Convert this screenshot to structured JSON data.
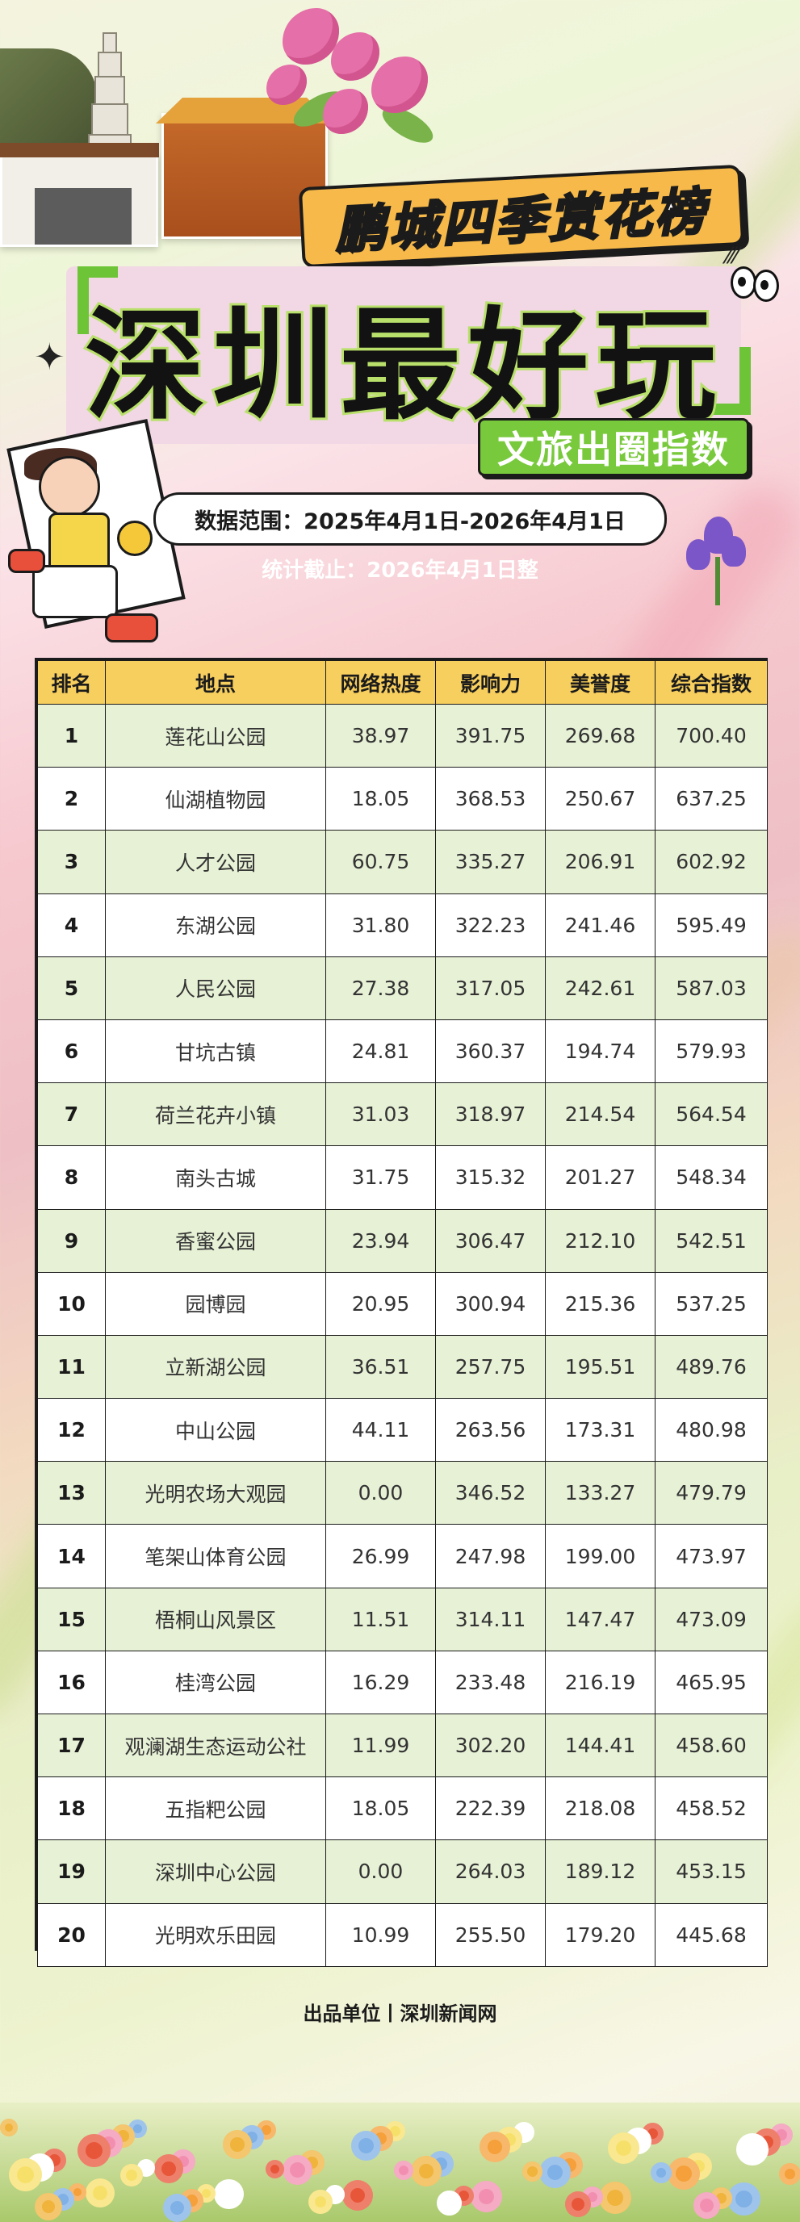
{
  "header": {
    "tag_title": "鹏城四季赏花榜",
    "main_title": "深圳最好玩",
    "sub_tag": "文旅出圈指数",
    "date_range": "数据范围：2025年4月1日-2026年4月1日",
    "cutoff": "统计截止：2026年4月1日整"
  },
  "table": {
    "headers": [
      "排名",
      "地点",
      "网络热度",
      "影响力",
      "美誉度",
      "综合指数"
    ],
    "rows": [
      [
        "1",
        "莲花山公园",
        "38.97",
        "391.75",
        "269.68",
        "700.40"
      ],
      [
        "2",
        "仙湖植物园",
        "18.05",
        "368.53",
        "250.67",
        "637.25"
      ],
      [
        "3",
        "人才公园",
        "60.75",
        "335.27",
        "206.91",
        "602.92"
      ],
      [
        "4",
        "东湖公园",
        "31.80",
        "322.23",
        "241.46",
        "595.49"
      ],
      [
        "5",
        "人民公园",
        "27.38",
        "317.05",
        "242.61",
        "587.03"
      ],
      [
        "6",
        "甘坑古镇",
        "24.81",
        "360.37",
        "194.74",
        "579.93"
      ],
      [
        "7",
        "荷兰花卉小镇",
        "31.03",
        "318.97",
        "214.54",
        "564.54"
      ],
      [
        "8",
        "南头古城",
        "31.75",
        "315.32",
        "201.27",
        "548.34"
      ],
      [
        "9",
        "香蜜公园",
        "23.94",
        "306.47",
        "212.10",
        "542.51"
      ],
      [
        "10",
        "园博园",
        "20.95",
        "300.94",
        "215.36",
        "537.25"
      ],
      [
        "11",
        "立新湖公园",
        "36.51",
        "257.75",
        "195.51",
        "489.76"
      ],
      [
        "12",
        "中山公园",
        "44.11",
        "263.56",
        "173.31",
        "480.98"
      ],
      [
        "13",
        "光明农场大观园",
        "0.00",
        "346.52",
        "133.27",
        "479.79"
      ],
      [
        "14",
        "笔架山体育公园",
        "26.99",
        "247.98",
        "199.00",
        "473.97"
      ],
      [
        "15",
        "梧桐山风景区",
        "11.51",
        "314.11",
        "147.47",
        "473.09"
      ],
      [
        "16",
        "桂湾公园",
        "16.29",
        "233.48",
        "216.19",
        "465.95"
      ],
      [
        "17",
        "观澜湖生态运动公社",
        "11.99",
        "302.20",
        "144.41",
        "458.60"
      ],
      [
        "18",
        "五指粑公园",
        "18.05",
        "222.39",
        "218.08",
        "458.52"
      ],
      [
        "19",
        "深圳中心公园",
        "0.00",
        "264.03",
        "189.12",
        "453.15"
      ],
      [
        "20",
        "光明欢乐田园",
        "10.99",
        "255.50",
        "179.20",
        "445.68"
      ]
    ]
  },
  "footer": {
    "credit": "出品单位丨深圳新闻网"
  },
  "colors": {
    "header_row": "#f7cf5e",
    "stripe_row": "#e7f1d6",
    "accent_green": "#79c93c",
    "accent_orange": "#f6b94a"
  },
  "decorations": [
    "pagoda-photo",
    "temple-photo",
    "bougainvillea-flowers",
    "girl-selfie-illustration",
    "iris-flower",
    "eyes-doodle",
    "sparkle-doodle",
    "flower-field"
  ]
}
